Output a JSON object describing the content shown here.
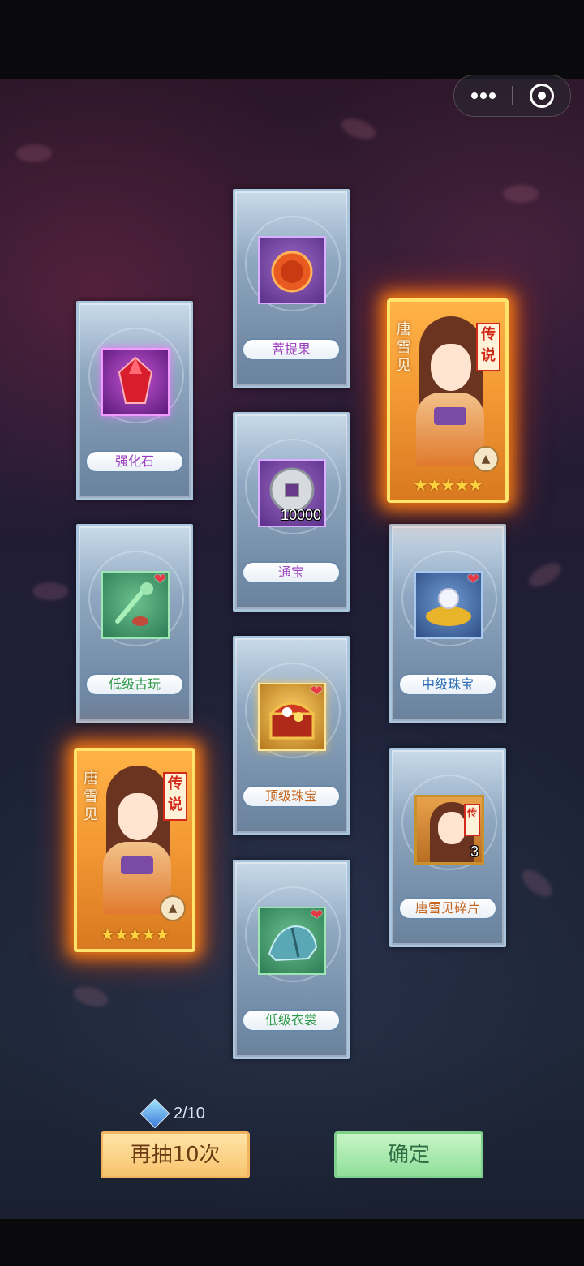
{
  "capsule": {
    "more_icon": "more-dots-icon",
    "close_icon": "target-close-icon"
  },
  "cards": {
    "stone": {
      "label": "强化石",
      "icon": "red-gem-icon"
    },
    "bodhi": {
      "label": "菩提果",
      "icon": "fruit-icon"
    },
    "coin": {
      "label": "通宝",
      "icon": "coin-icon",
      "quantity": "10000"
    },
    "antique": {
      "label": "低级古玩",
      "icon": "jade-antique-icon"
    },
    "jewel_mid": {
      "label": "中级珠宝",
      "icon": "gold-pearl-icon"
    },
    "jewel_top": {
      "label": "顶级珠宝",
      "icon": "treasure-chest-icon"
    },
    "clothes": {
      "label": "低级衣裳",
      "icon": "garment-icon"
    },
    "fragment": {
      "label": "唐雪见碎片",
      "tag": "传",
      "quantity": "3"
    }
  },
  "heroes": {
    "hero_top": {
      "name_chars": [
        "唐",
        "雪",
        "见"
      ],
      "rarity_chars": [
        "传",
        "说"
      ],
      "stars": "★★★★★"
    },
    "hero_left": {
      "name_chars": [
        "唐",
        "雪",
        "见"
      ],
      "rarity_chars": [
        "传",
        "说"
      ],
      "stars": "★★★★★"
    }
  },
  "footer": {
    "draw_count": "2/10",
    "draw_again_label": "再抽10次",
    "confirm_label": "确定"
  },
  "colors": {
    "legend_glow": "#ff8214",
    "label_purple": "#9b3dbd",
    "label_green": "#2f9b4a",
    "label_blue": "#2b6ab5",
    "label_orange": "#c7651f"
  }
}
